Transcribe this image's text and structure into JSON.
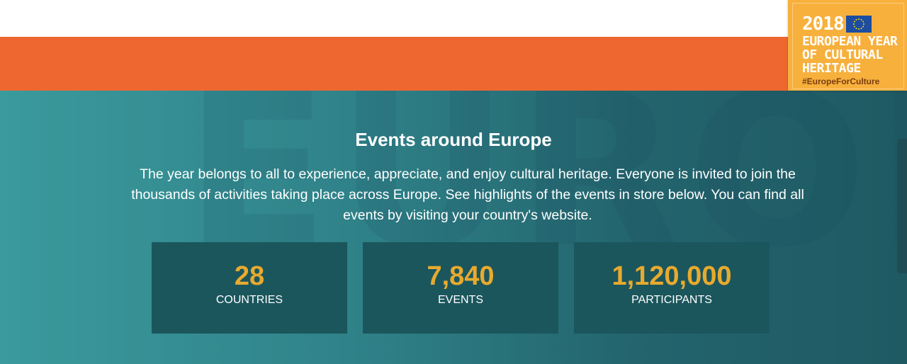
{
  "badge": {
    "year": "2018",
    "lines": [
      "EUROPEAN YEAR",
      "OF CULTURAL",
      "HERITAGE"
    ],
    "hashtag": "#EuropeForCulture",
    "flag_icon": "eu-flag-icon",
    "color": "#f7b03c"
  },
  "colors": {
    "orange_band": "#ee6731",
    "teal": "#2f8188",
    "stat_box": "#1b565d",
    "stat_value": "#e8aa2e"
  },
  "section": {
    "background_word": "EUROPE",
    "title": "Events around Europe",
    "text": "The year belongs to all to experience, appreciate, and enjoy cultural heritage. Everyone is invited to join the thousands of activities taking place across Europe. See highlights of the events in store below. You can find all events by visiting your country's website.",
    "stats": [
      {
        "value": "28",
        "label": "COUNTRIES"
      },
      {
        "value": "7,840",
        "label": "EVENTS"
      },
      {
        "value": "1,120,000",
        "label": "PARTICIPANTS"
      }
    ]
  }
}
